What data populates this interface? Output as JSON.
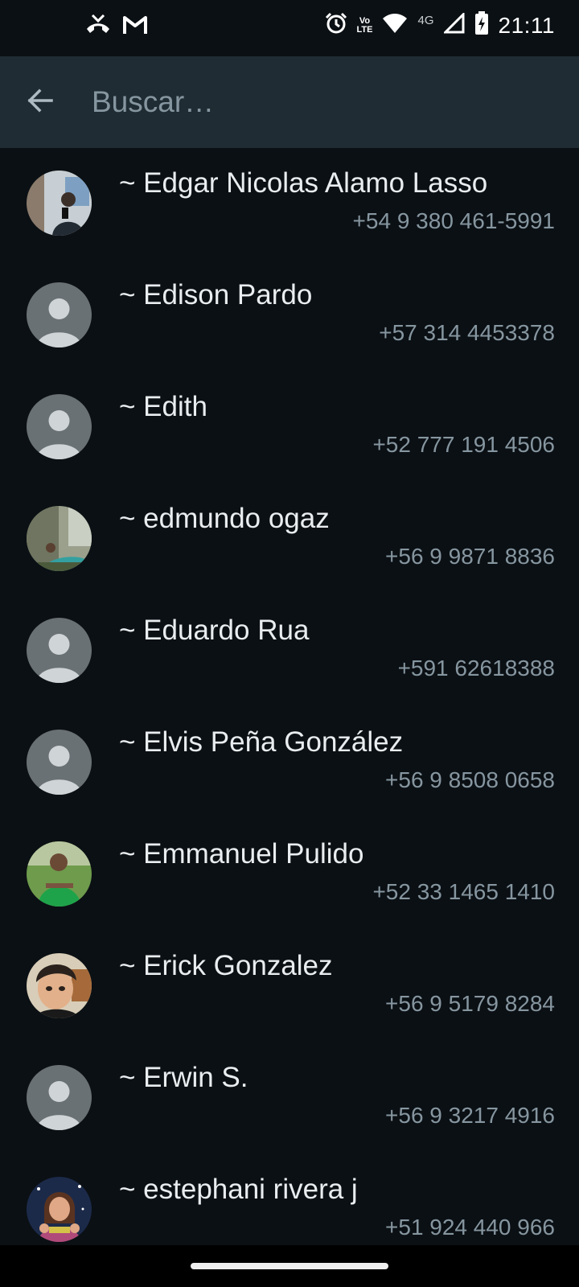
{
  "status_bar": {
    "time": "21:11",
    "network": "4G",
    "volte_top": "Vo",
    "volte_bottom": "LTE",
    "icons_left": [
      "missed-call-icon",
      "gmail-icon"
    ],
    "icons_right": [
      "alarm-icon",
      "volte-icon",
      "wifi-icon",
      "signal-icon",
      "battery-charging-icon"
    ]
  },
  "search": {
    "placeholder": "Buscar…",
    "value": ""
  },
  "contacts": [
    {
      "name": "~ Edgar Nicolas Alamo Lasso",
      "phone": "+54 9 380 461-5991",
      "avatar": "photo"
    },
    {
      "name": "~ Edison Pardo",
      "phone": "+57 314 4453378",
      "avatar": "default"
    },
    {
      "name": "~ Edith",
      "phone": "+52 777 191 4506",
      "avatar": "default"
    },
    {
      "name": "~ edmundo ogaz",
      "phone": "+56 9 9871 8836",
      "avatar": "photo"
    },
    {
      "name": "~ Eduardo Rua",
      "phone": "+591 62618388",
      "avatar": "default"
    },
    {
      "name": "~ Elvis Peña González",
      "phone": "+56 9 8508 0658",
      "avatar": "default"
    },
    {
      "name": "~ Emmanuel Pulido",
      "phone": "+52 33 1465 1410",
      "avatar": "photo"
    },
    {
      "name": "~ Erick Gonzalez",
      "phone": "+56 9 5179 8284",
      "avatar": "photo"
    },
    {
      "name": "~ Erwin S.",
      "phone": "+56 9 3217 4916",
      "avatar": "default"
    },
    {
      "name": "~ estephani rivera j",
      "phone": "+51 924 440 966",
      "avatar": "photo"
    }
  ],
  "colors": {
    "background": "#0b1014",
    "header": "#1f2c33",
    "primary_text": "#e9edef",
    "secondary_text": "#8696a0",
    "default_avatar_bg": "#6a7175",
    "default_avatar_fg": "#cfd4d6"
  }
}
